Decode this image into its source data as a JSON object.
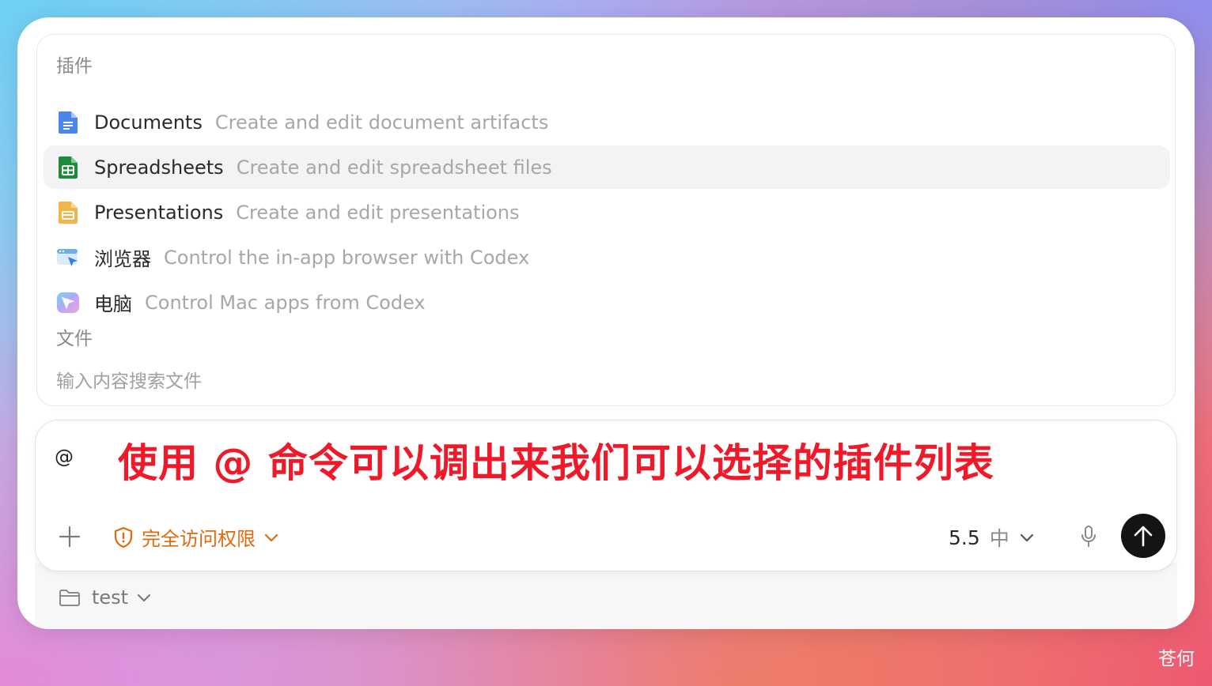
{
  "plugins_section": {
    "label": "插件",
    "items": [
      {
        "name": "Documents",
        "desc": "Create and edit document artifacts",
        "icon": "document-icon"
      },
      {
        "name": "Spreadsheets",
        "desc": "Create and edit spreadsheet files",
        "icon": "spreadsheet-icon"
      },
      {
        "name": "Presentations",
        "desc": "Create and edit presentations",
        "icon": "presentation-icon"
      },
      {
        "name": "浏览器",
        "desc": "Control the in-app browser with Codex",
        "icon": "browser-icon"
      },
      {
        "name": "电脑",
        "desc": "Control Mac apps from Codex",
        "icon": "computer-icon"
      }
    ],
    "selected_index": 1
  },
  "files_section": {
    "label": "文件",
    "placeholder": "输入内容搜索文件"
  },
  "composer": {
    "input_value": "@",
    "annotation": "使用 @ 命令可以调出来我们可以选择的插件列表",
    "access_label": "完全访问权限",
    "model_version": "5.5",
    "model_level": "中"
  },
  "footer": {
    "project_name": "test"
  },
  "watermark": "苍何",
  "colors": {
    "accent_orange": "#e06a0f",
    "annotation_red": "#f0192a",
    "send_button": "#141414"
  }
}
